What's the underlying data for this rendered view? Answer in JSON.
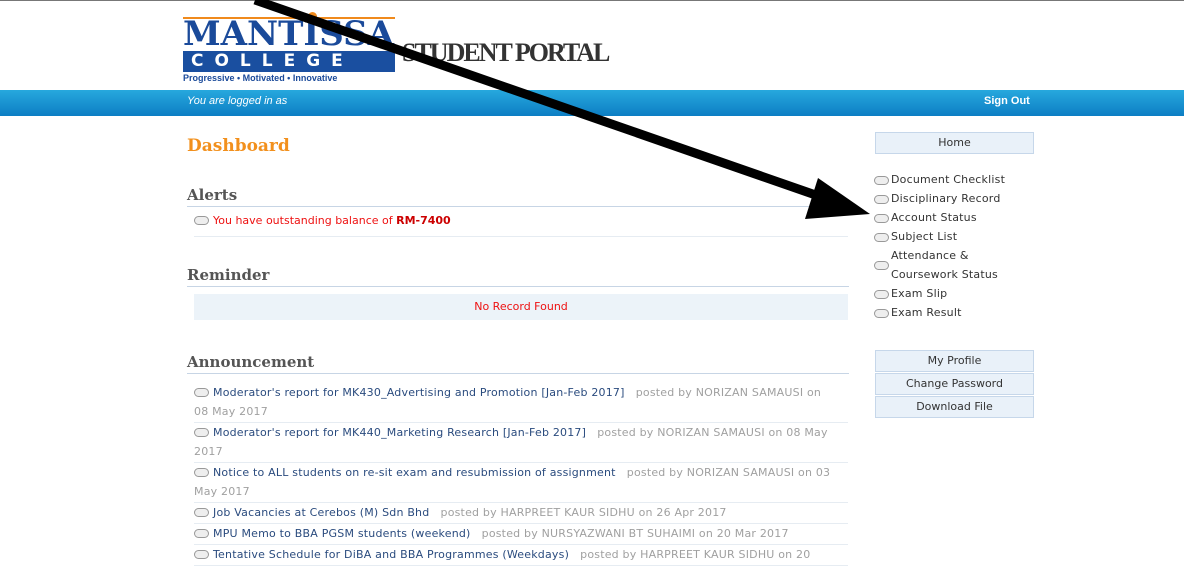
{
  "logo": {
    "top_word": "MANTISSA",
    "bottom_word": "COLLEGE",
    "tagline": "Progressive • Motivated • Innovative"
  },
  "portal_title": "STUDENT PORTAL",
  "topbar": {
    "logged_in_text": "You are logged in as",
    "sign_out": "Sign Out"
  },
  "page_title": "Dashboard",
  "alerts": {
    "title": "Alerts",
    "message": "You have outstanding balance of",
    "amount": "RM-7400"
  },
  "reminder": {
    "title": "Reminder",
    "empty": "No Record Found"
  },
  "announcement": {
    "title": "Announcement",
    "items": [
      {
        "text": "Moderator's report for MK430_Advertising and Promotion [Jan-Feb 2017]",
        "by": "posted by NORIZAN SAMAUSI on 08 May 2017"
      },
      {
        "text": "Moderator's report for MK440_Marketing Research [Jan-Feb 2017]",
        "by": "posted by NORIZAN SAMAUSI on 08 May 2017"
      },
      {
        "text": "Notice to ALL students on re-sit exam and resubmission of assignment",
        "by": "posted by NORIZAN SAMAUSI on 03 May 2017"
      },
      {
        "text": "Job Vacancies at Cerebos (M) Sdn Bhd",
        "by": "posted by HARPREET KAUR SIDHU on 26 Apr 2017"
      },
      {
        "text": "MPU Memo to BBA PGSM students (weekend)",
        "by": "posted by NURSYAZWANI BT SUHAIMI on 20 Mar 2017"
      },
      {
        "text": "Tentative Schedule for DiBA and BBA Programmes (Weekdays)",
        "by": "posted by HARPREET KAUR SIDHU on 20"
      }
    ]
  },
  "sidebar": {
    "home": "Home",
    "links": [
      "Document Checklist",
      "Disciplinary Record",
      "Account Status",
      "Subject List",
      "Attendance & Coursework Status",
      "Exam Slip",
      "Exam Result"
    ],
    "my_profile": "My Profile",
    "change_password": "Change Password",
    "download_file": "Download File"
  },
  "colors": {
    "topbar": "#1494d4",
    "heading_orange": "#f2901d",
    "alert_red": "#ee1111",
    "annotation_arrow": "#000000"
  }
}
